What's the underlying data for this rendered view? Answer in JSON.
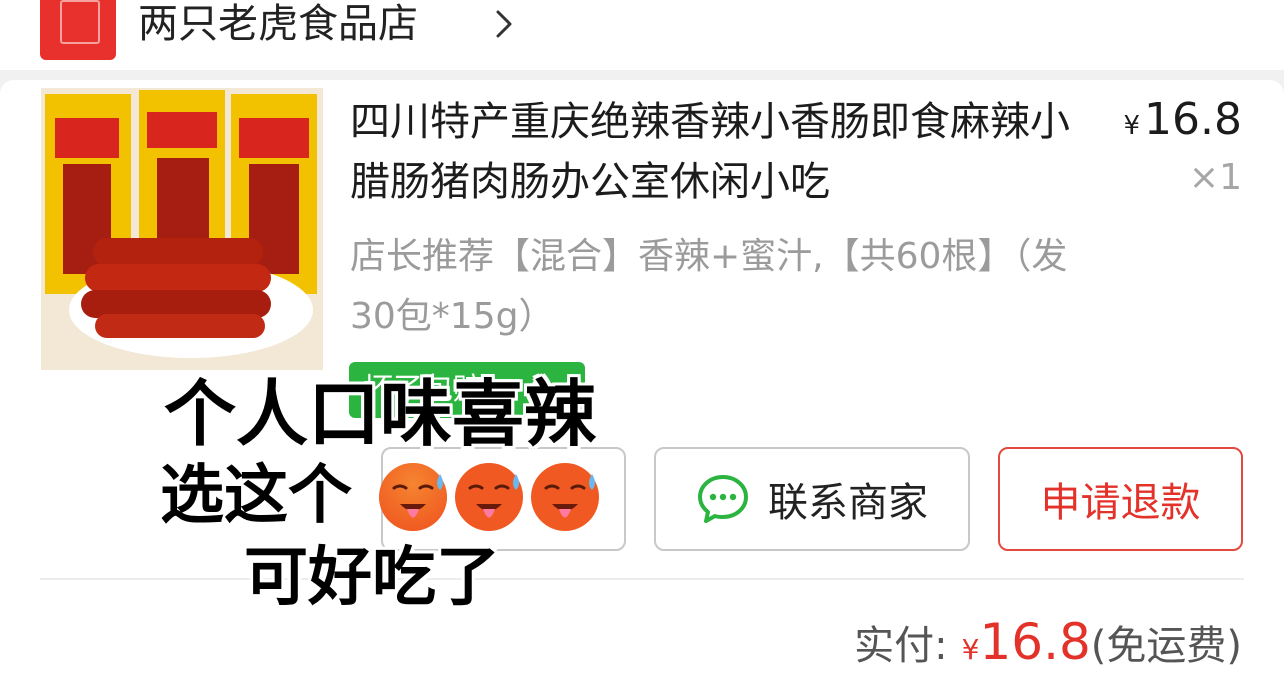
{
  "store": {
    "name": "两只老虎食品店"
  },
  "product": {
    "title": "四川特产重庆绝辣香辣小香肠即食麻辣小腊肠猪肉肠办公室休闲小吃",
    "price_symbol": "¥",
    "price": "16.8",
    "quantity": "×1",
    "spec": "店长推荐【混合】香辣+蜜汁,【共60根】（发30包*15g）",
    "tag": "坏了包赔"
  },
  "actions": {
    "button_1": "",
    "contact": "联系商家",
    "refund": "申请退款"
  },
  "summary": {
    "label": "实付:",
    "symbol": "¥",
    "amount": "16.8",
    "shipping": "(免运费)"
  },
  "overlay": {
    "line1": "个人口味喜辣",
    "line2": "选这个",
    "line3": "可好吃了",
    "emoji_name": "hot-face-emoji"
  },
  "colors": {
    "accent_red": "#e3322a",
    "tag_green": "#2bb43f",
    "wechat_green": "#2bb43f"
  }
}
